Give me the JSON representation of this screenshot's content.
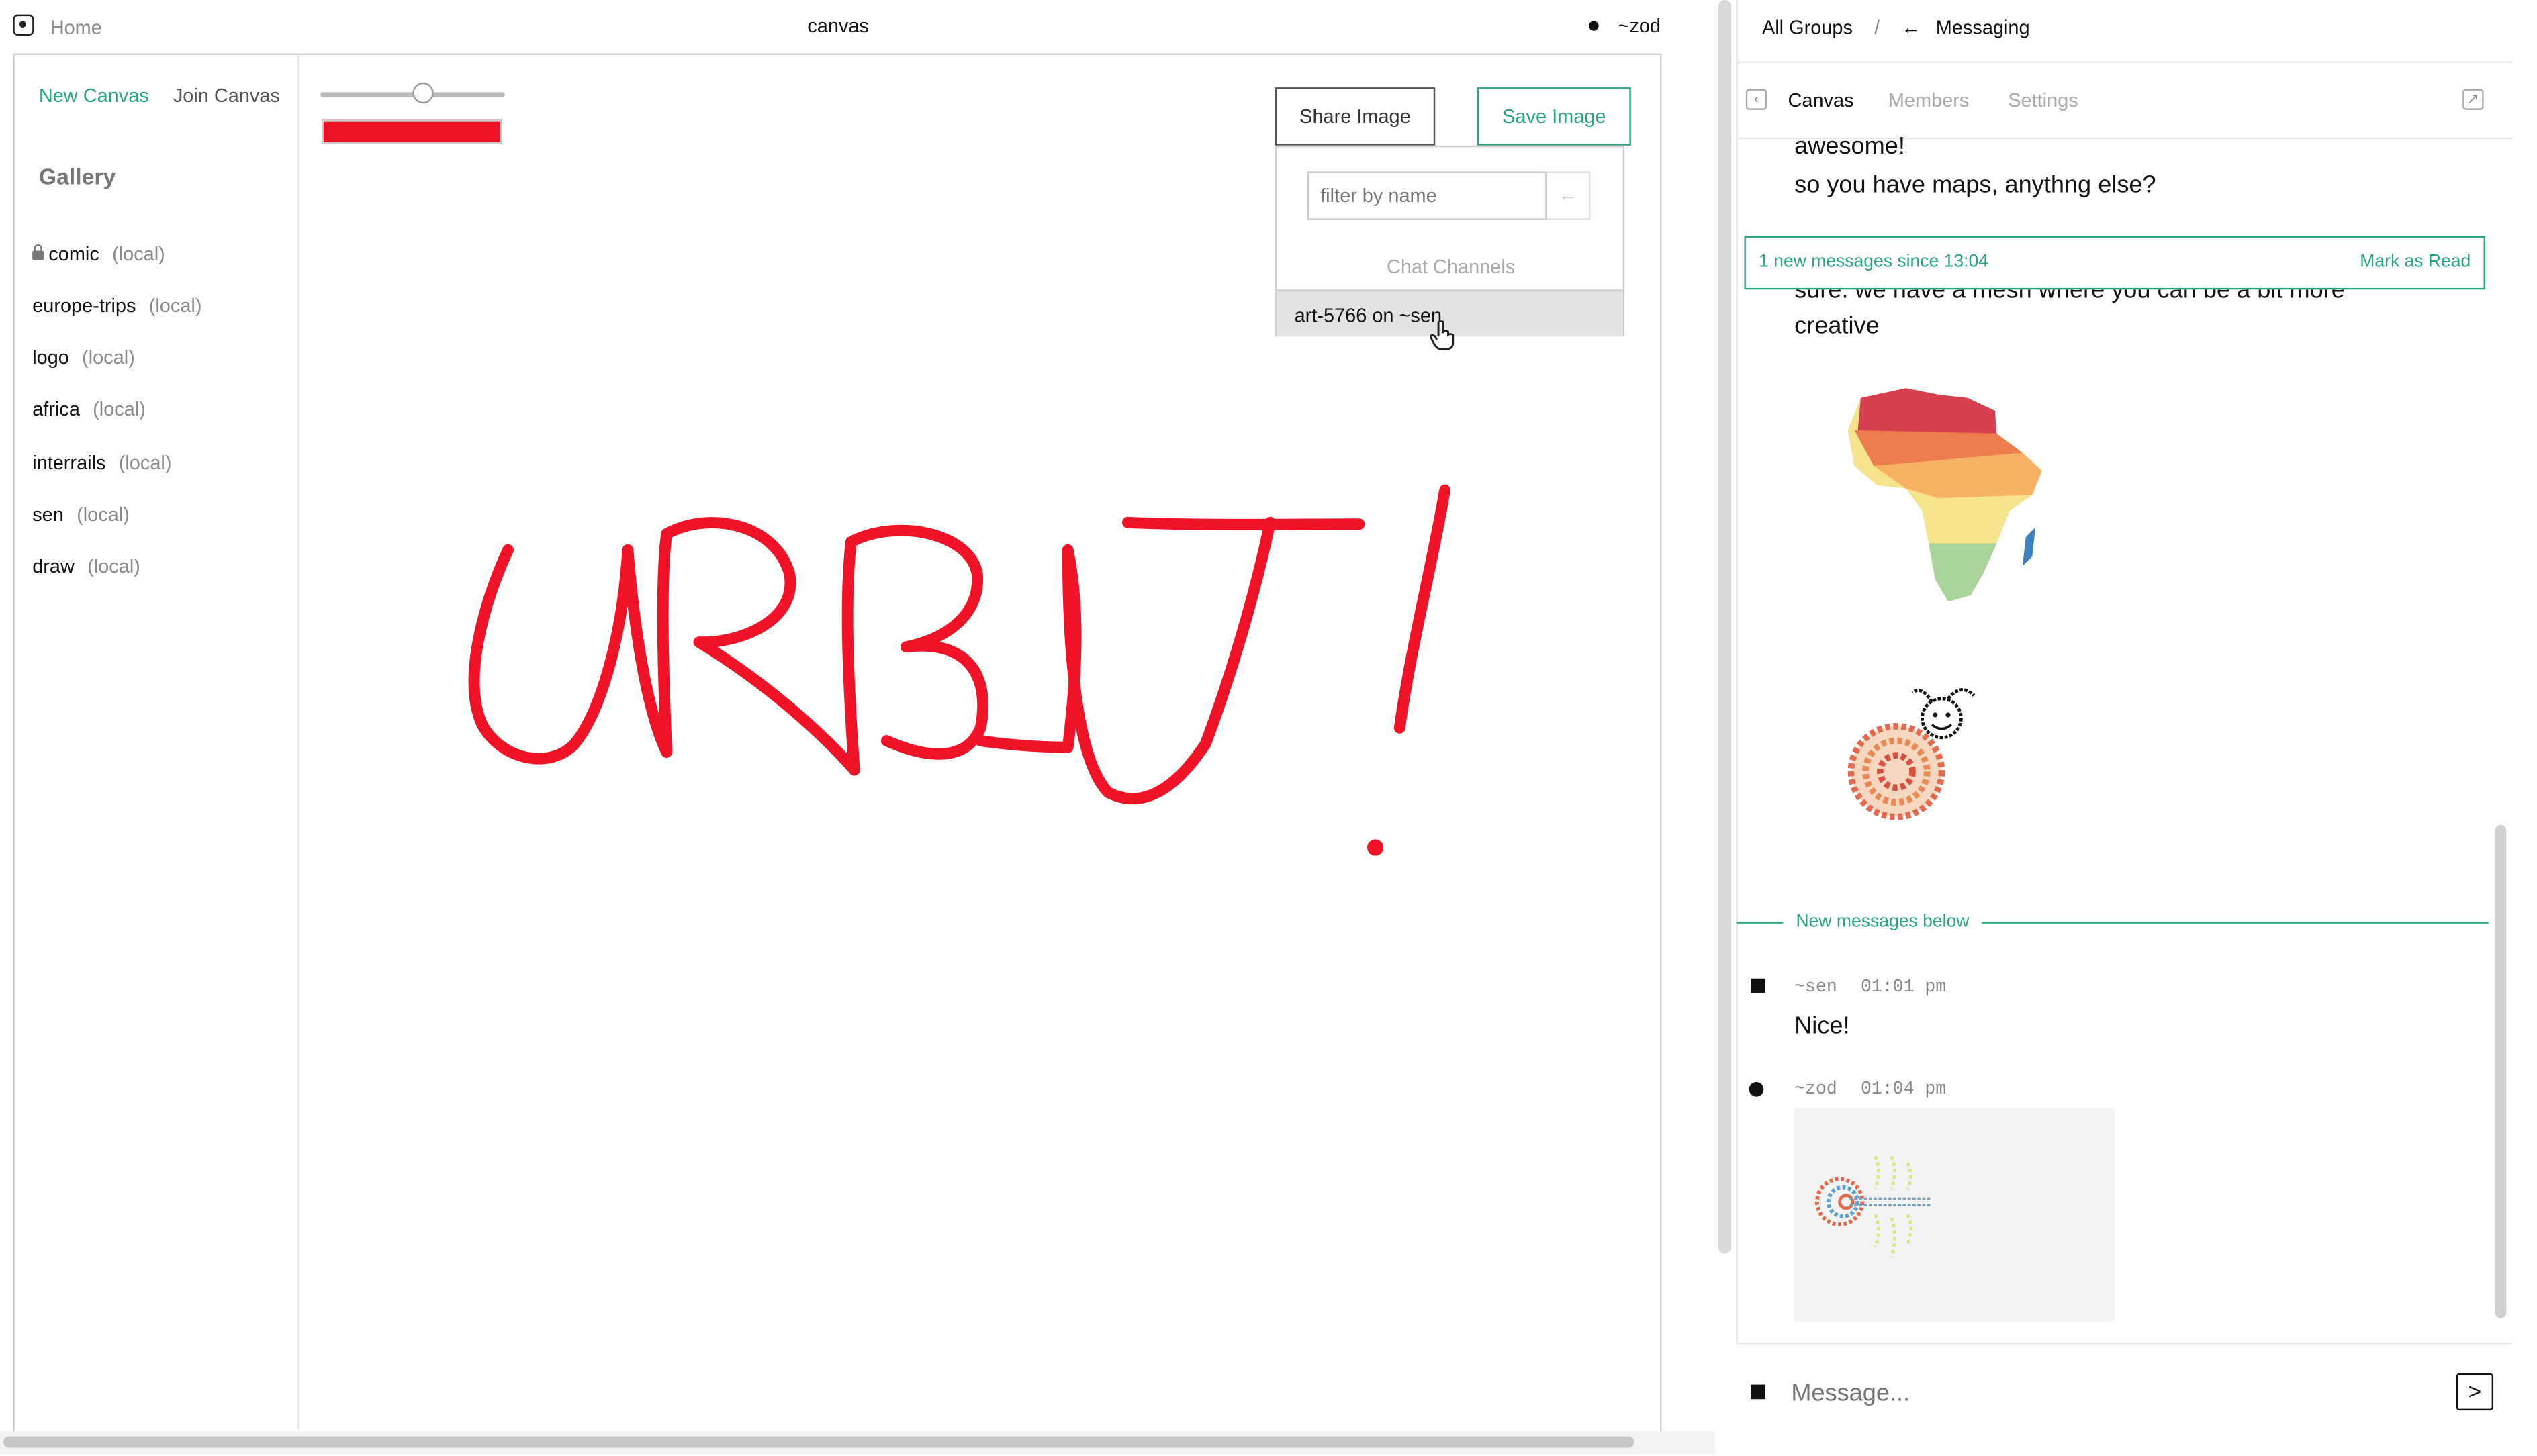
{
  "left_header": {
    "home": "Home",
    "title": "canvas",
    "user": "~zod"
  },
  "sidebar": {
    "new_canvas": "New Canvas",
    "join_canvas": "Join Canvas",
    "gallery_title": "Gallery",
    "items": [
      {
        "name": "comic",
        "tag": "(local)",
        "locked": true
      },
      {
        "name": "europe-trips",
        "tag": "(local)"
      },
      {
        "name": "logo",
        "tag": "(local)"
      },
      {
        "name": "africa",
        "tag": "(local)"
      },
      {
        "name": "interrails",
        "tag": "(local)"
      },
      {
        "name": "sen",
        "tag": "(local)"
      },
      {
        "name": "draw",
        "tag": "(local)"
      }
    ]
  },
  "toolbar": {
    "brush_size": 0.55,
    "brush_color": "#f01226",
    "share_label": "Share Image",
    "save_label": "Save Image"
  },
  "share_dropdown": {
    "filter_placeholder": "filter by name",
    "section_label": "Chat Channels",
    "channel": "art-5766 on ~sen"
  },
  "canvas": {
    "stroke_color": "#f01226"
  },
  "right_header": {
    "all_groups": "All Groups",
    "separator": "/",
    "back_arrow": "←",
    "section": "Messaging"
  },
  "chat_tabs": {
    "canvas": "Canvas",
    "members": "Members",
    "settings": "Settings"
  },
  "messages": {
    "m1": "awesome!",
    "m2": "so you have maps, anythng else?",
    "m3_partial": "sure. we have a mesh where you can be a bit more",
    "m3_cont": "creative",
    "new_below": "New messages below",
    "sen_author": "~sen",
    "sen_time": "01:01 pm",
    "sen_text": "Nice!",
    "zod_author": "~zod",
    "zod_time": "01:04 pm"
  },
  "banner": {
    "text": "1 new messages since 13:04",
    "action": "Mark as Read"
  },
  "composer": {
    "placeholder": "Message...",
    "send_glyph": ">"
  }
}
